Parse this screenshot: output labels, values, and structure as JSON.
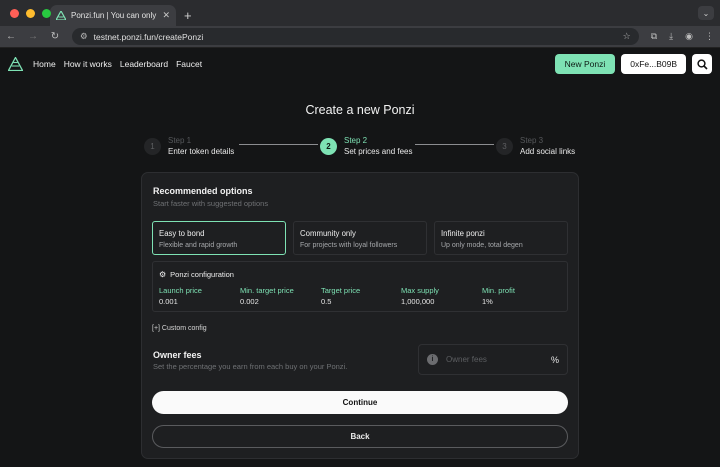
{
  "browser": {
    "tab_title": "Ponzi.fun | You can only sell h",
    "url": "testnet.ponzi.fun/createPonzi"
  },
  "nav": {
    "links": [
      "Home",
      "How it works",
      "Leaderboard",
      "Faucet"
    ],
    "new_ponzi": "New Ponzi",
    "wallet": "0xFe...B09B"
  },
  "page": {
    "title": "Create a new Ponzi"
  },
  "steps": [
    {
      "number": "1",
      "kicker": "Step 1",
      "label": "Enter token details",
      "state": "done"
    },
    {
      "number": "2",
      "kicker": "Step 2",
      "label": "Set prices and fees",
      "state": "active"
    },
    {
      "number": "3",
      "kicker": "Step 3",
      "label": "Add social links",
      "state": "upcoming"
    }
  ],
  "recommended": {
    "title": "Recommended options",
    "subtitle": "Start faster with suggested options",
    "options": [
      {
        "title": "Easy to bond",
        "desc": "Flexible and rapid growth",
        "selected": true
      },
      {
        "title": "Community only",
        "desc": "For projects with loyal followers",
        "selected": false
      },
      {
        "title": "Infinite ponzi",
        "desc": "Up only mode, total degen",
        "selected": false
      }
    ]
  },
  "config": {
    "title": "Ponzi configuration",
    "columns": [
      {
        "label": "Launch price",
        "value": "0.001"
      },
      {
        "label": "Min. target price",
        "value": "0.002"
      },
      {
        "label": "Target price",
        "value": "0.5"
      },
      {
        "label": "Max supply",
        "value": "1,000,000"
      },
      {
        "label": "Min. profit",
        "value": "1%"
      }
    ]
  },
  "custom_config": "[+] Custom config",
  "fees": {
    "title": "Owner fees",
    "subtitle": "Set the percentage you earn from each buy on your Ponzi.",
    "placeholder": "Owner fees",
    "unit": "%"
  },
  "buttons": {
    "continue": "Continue",
    "back": "Back"
  },
  "colors": {
    "accent": "#7ee2b4",
    "background": "#141516",
    "card": "#1e1f21"
  }
}
